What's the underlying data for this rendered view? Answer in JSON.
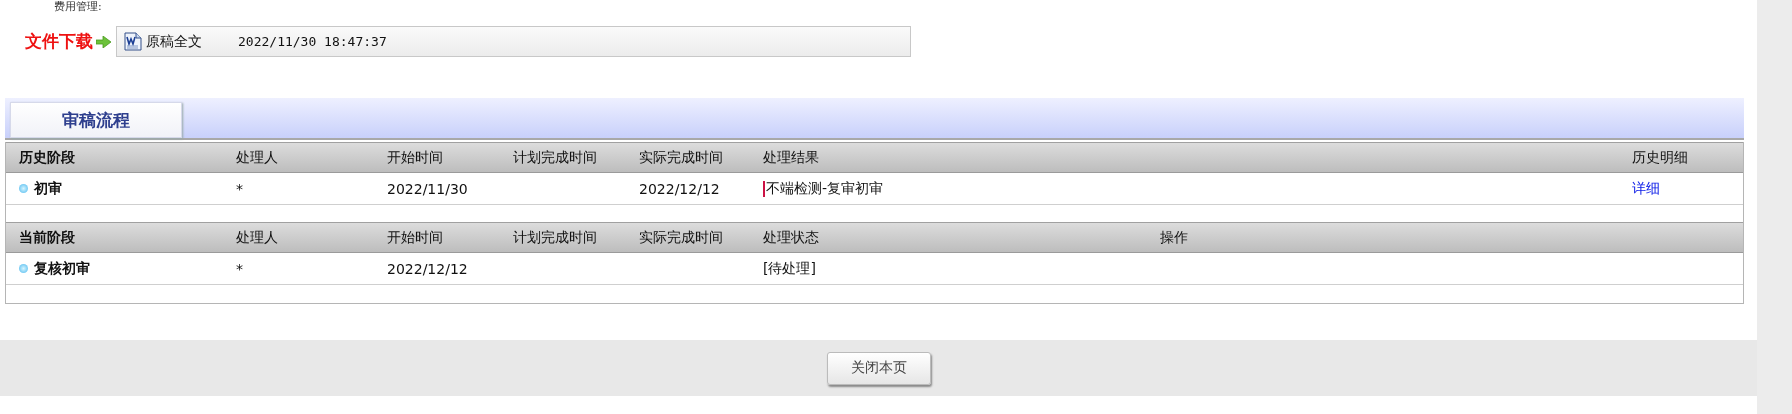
{
  "top_text": "费用管理:",
  "download": {
    "label": "文件下载",
    "file_name": "原稿全文",
    "file_time": "2022/11/30 18:47:37"
  },
  "tabs": [
    {
      "label": "审稿流程",
      "selected": true
    }
  ],
  "history": {
    "columns": [
      "历史阶段",
      "处理人",
      "开始时间",
      "计划完成时间",
      "实际完成时间",
      "处理结果",
      "历史明细"
    ],
    "rows": [
      {
        "stage": "初审",
        "handler": "*",
        "start": "2022/11/30",
        "planned": "",
        "actual": "2022/12/12",
        "result": "不端检测-复审初审",
        "detail_link": "详细"
      }
    ]
  },
  "current": {
    "columns": [
      "当前阶段",
      "处理人",
      "开始时间",
      "计划完成时间",
      "实际完成时间",
      "处理状态",
      "操作"
    ],
    "rows": [
      {
        "stage": "复核初审",
        "handler": "*",
        "start": "2022/12/12",
        "planned": "",
        "actual": "",
        "status": "[待处理]"
      }
    ]
  },
  "footer": {
    "close_button": "关闭本页"
  }
}
